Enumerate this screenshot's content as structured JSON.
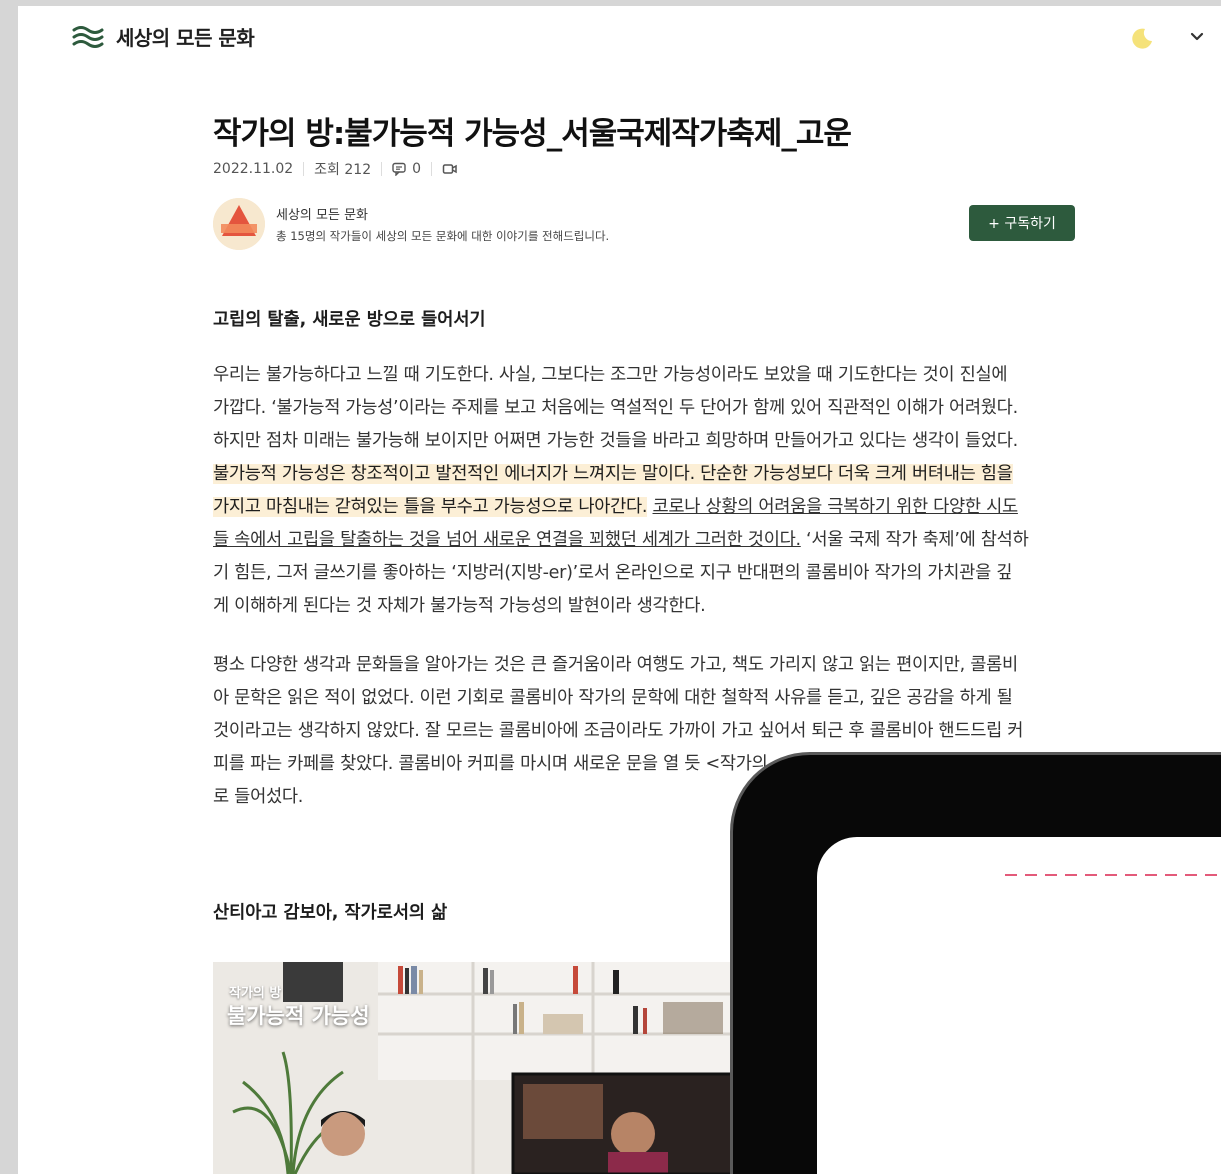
{
  "header": {
    "brand": "세상의 모든 문화",
    "logo_icon": "waves-logo-icon",
    "theme_icon": "moon-icon",
    "menu_icon": "chevron-down-icon"
  },
  "article": {
    "title": "작가의 방:불가능적 가능성_서울국제작가축제_고운",
    "date": "2022.11.02",
    "views": "조회 212",
    "comments": "0",
    "channel_name": "세상의 모든 문화",
    "channel_desc": "총 15명의 작가들이 세상의 모든 문화에 대한 이야기를 전해드립니다.",
    "subscribe_label": "+ 구독하기",
    "section1_title": "고립의 탈출, 새로운 방으로 들어서기",
    "p1": {
      "l1": " 우리는 불가능하다고 느낄 때 기도한다. 사실, 그보다는 조그만 가능성이라도 보았을 때 기도한다는 것이 진실에",
      "l2": "가깝다. ‘불가능적 가능성’이라는 주제를 보고 처음에는 역설적인 두 단어가 함께 있어 직관적인 이해가 어려웠다.",
      "l3": "하지만 점차 미래는 불가능해 보이지만 어쩌면 가능한 것들을 바라고 희망하며 만들어가고 있다는 생각이 들었다.",
      "l4_hl": "불가능적 가능성은 창조적이고 발전적인 에너지가 느껴지는 말이다. 단순한 가능성보다 더욱 크게 버텨내는 힘을",
      "l5_hl": "가지고 마침내는 갇혀있는 틀을 부수고 가능성으로 나아간다.",
      "l5_ul": "코로나 상황의 어려움을 극복하기 위한 다양한 시도",
      "l6_ul": "들 속에서 고립을 탈출하는 것을 넘어 새로운 연결을 꾀했던 세계가 그러한 것이다.",
      "l6_rest": " ‘서울 국제 작가 축제’에 참석하",
      "l7": "기 힘든, 그저 글쓰기를 좋아하는 ‘지방러(지방-er)’로서 온라인으로 지구 반대편의 콜롬비아 작가의 가치관을 깊",
      "l8": "게 이해하게 된다는 것 자체가 불가능적 가능성의 발현이라 생각한다."
    },
    "p2": {
      "l1": " 평소 다양한 생각과 문화들을 알아가는 것은 큰 즐거움이라 여행도 가고, 책도 가리지 않고 읽는 편이지만, 콜롬비",
      "l2": "아 문학은 읽은 적이 없었다. 이런 기회로 콜롬비아 작가의 문학에 대한 철학적 사유를 듣고, 깊은 공감을 하게 될",
      "l3": "것이라고는 생각하지 않았다. 잘 모르는 콜롬비아에 조금이라도 가까이 가고 싶어서 퇴근 후 콜롬비아 핸드드립 커",
      "l4": "피를 파는 카페를 찾았다. 콜롬비아 커피를 마시며 새로운 문을 열 듯 <작가의",
      "l5": "로 들어섰다."
    },
    "section2_title": "산티아고 감보아, 작가로서의 삶",
    "video": {
      "caption_small": "작가의 방",
      "caption_large": "불가능적 가능성"
    }
  }
}
